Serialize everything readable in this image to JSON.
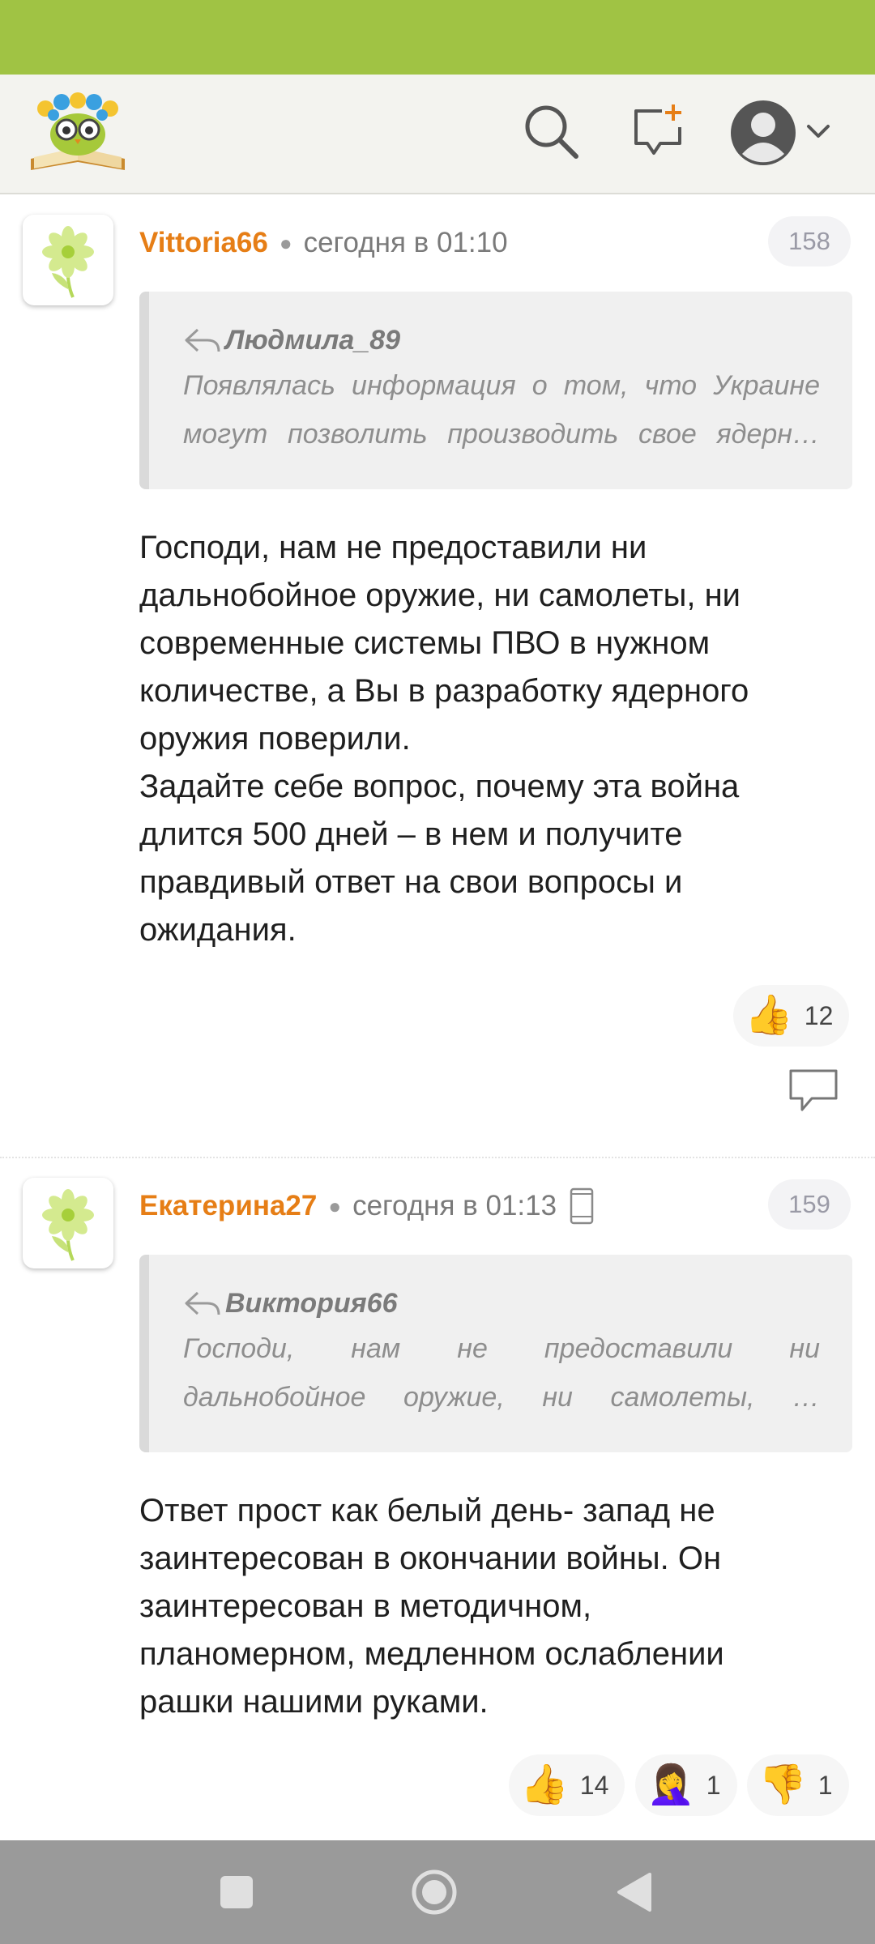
{
  "colors": {
    "status_bar": "#a0c344",
    "accent": "#e67e16",
    "navbar": "#9a9a9a"
  },
  "header": {
    "logo": "app-logo-owl-with-flowers",
    "icons": [
      "search-icon",
      "new-message-icon",
      "user-avatar-icon",
      "chevron-down-icon"
    ]
  },
  "comments": [
    {
      "author": "Vittoria66",
      "time": "сегодня в 01:10",
      "number": "158",
      "quote": {
        "author": "Людмила_89",
        "line1": "Появлялась информация о том, что Украине",
        "line2": "могут позволить производить свое ядерн…"
      },
      "text": "Господи, нам не предоставили ни\nдальнобойное оружие, ни самолеты, ни\nсовременные системы ПВО в нужном\nколичестве, а Вы в разработку ядерного\nоружия поверили.\nЗадайте себе вопрос, почему эта война\nдлится 500 дней – в нем и получите\nправдивый ответ на свои вопросы и\nожидания.",
      "reactions": [
        {
          "emoji": "👍",
          "count": "12"
        }
      ]
    },
    {
      "author": "Екатерина27",
      "time": "сегодня в 01:13",
      "number": "159",
      "quote": {
        "author": "Виктория66",
        "line1": "Господи, нам не предоставили ни",
        "line2": "дальнобойное оружие, ни самолеты, …"
      },
      "text": "Ответ прост как белый день- запад не\nзаинтересован в окончании войны. Он\nзаинтересован в методичном,\nпланомерном, медленном ослаблении\nрашки нашими руками.",
      "reactions": [
        {
          "emoji": "👍",
          "count": "14"
        },
        {
          "emoji": "🤦‍♀️",
          "count": "1"
        },
        {
          "emoji": "👎",
          "count": "1"
        }
      ]
    }
  ],
  "navbar": {
    "icons": [
      "recent-apps-icon",
      "home-icon",
      "back-icon"
    ]
  }
}
